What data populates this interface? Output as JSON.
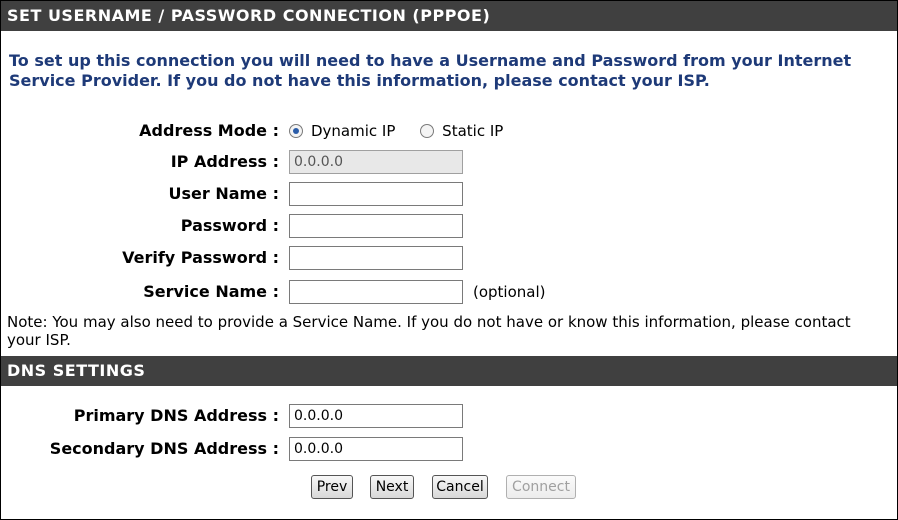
{
  "pppoe_section": {
    "title": "SET USERNAME / PASSWORD CONNECTION (PPPOE)",
    "intro": "To set up this connection you will need to have a Username and Password from your Internet Service Provider. If you do not have this information, please contact your ISP.",
    "address_mode": {
      "label": "Address Mode :",
      "options": [
        "Dynamic IP",
        "Static IP"
      ],
      "selected": "Dynamic IP"
    },
    "ip_address": {
      "label": "IP Address :",
      "value": "0.0.0.0"
    },
    "user_name": {
      "label": "User Name :",
      "value": ""
    },
    "password": {
      "label": "Password :",
      "value": ""
    },
    "verify_password": {
      "label": "Verify Password :",
      "value": ""
    },
    "service_name": {
      "label": "Service Name :",
      "value": "",
      "hint": "(optional)"
    },
    "note": "Note: You may also need to provide a Service Name. If you do not have or know this information, please contact your ISP."
  },
  "dns_section": {
    "title": "DNS SETTINGS",
    "primary": {
      "label": "Primary DNS Address :",
      "value": "0.0.0.0"
    },
    "secondary": {
      "label": "Secondary DNS Address :",
      "value": "0.0.0.0"
    }
  },
  "buttons": {
    "prev": "Prev",
    "next": "Next",
    "cancel": "Cancel",
    "connect": "Connect"
  },
  "colors": {
    "header_bg": "#404040",
    "intro_text": "#1e3a78"
  }
}
